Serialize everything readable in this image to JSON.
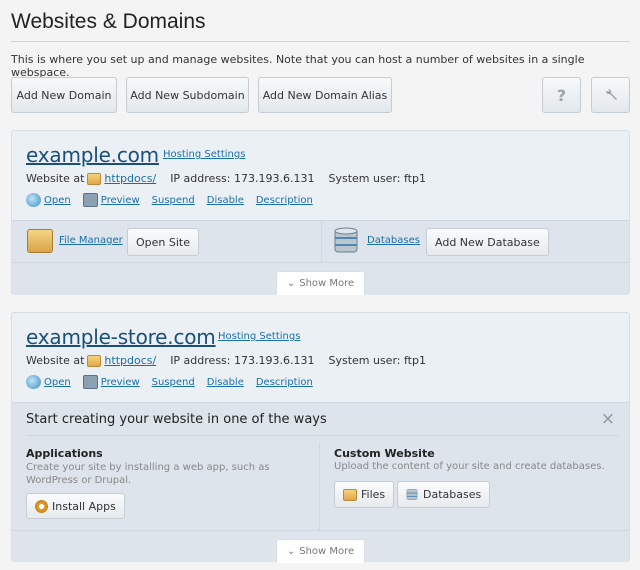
{
  "page": {
    "title": "Websites & Domains",
    "description": "This is where you set up and manage websites. Note that you can host a number of websites in a single webspace."
  },
  "toolbar": {
    "add_domain": "Add New Domain",
    "add_subdomain": "Add New Subdomain",
    "add_alias": "Add New Domain Alias",
    "help_icon": "?",
    "settings_icon": "wrench"
  },
  "domains": [
    {
      "name": "example.com",
      "hosting_settings": "Hosting Settings",
      "website_at": "Website at",
      "docroot": "httpdocs/",
      "ip": "IP address: 173.193.6.131",
      "user": "System user: ftp1",
      "actions": [
        "Open",
        "Preview",
        "Suspend",
        "Disable",
        "Description"
      ],
      "file_manager": "File Manager",
      "open_site": "Open Site",
      "databases": "Databases",
      "add_database": "Add New Database",
      "show_more": "Show More"
    },
    {
      "name": "example-store.com",
      "hosting_settings": "Hosting Settings",
      "website_at": "Website at",
      "docroot": "httpdocs/",
      "ip": "IP address: 173.193.6.131",
      "user": "System user: ftp1",
      "actions": [
        "Open",
        "Preview",
        "Suspend",
        "Disable",
        "Description"
      ],
      "start": {
        "title": "Start creating your website in one of the ways",
        "close": "×",
        "apps_title": "Applications",
        "apps_desc": "Create your site by installing a web app, such as WordPress or Drupal.",
        "install_apps": "Install Apps",
        "custom_title": "Custom Website",
        "custom_desc": "Upload the content of your site and create databases.",
        "files": "Files",
        "databases": "Databases"
      },
      "show_more": "Show More"
    }
  ]
}
